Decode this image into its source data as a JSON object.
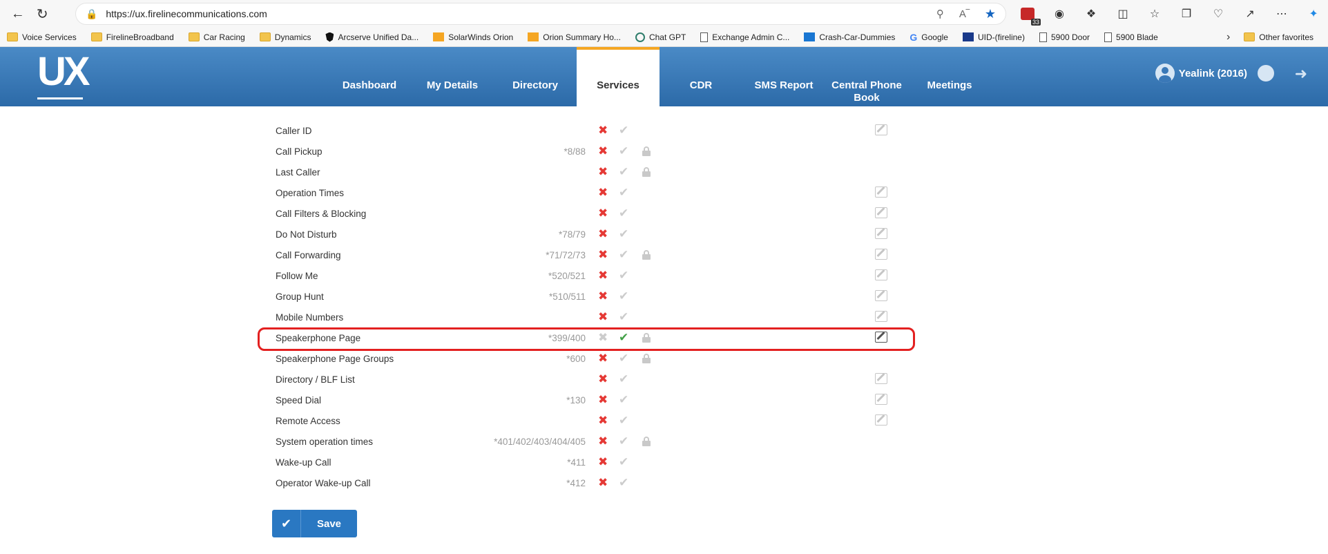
{
  "browser": {
    "url": "https://ux.firelinecommunications.com",
    "extension_badge": "33",
    "bookmarks": [
      {
        "label": "Voice Services",
        "icon": "folder-icon"
      },
      {
        "label": "FirelineBroadband",
        "icon": "folder-icon"
      },
      {
        "label": "Car Racing",
        "icon": "folder-icon"
      },
      {
        "label": "Dynamics",
        "icon": "folder-icon"
      },
      {
        "label": "Arcserve Unified Da...",
        "icon": "shield-icon"
      },
      {
        "label": "SolarWinds Orion",
        "icon": "orion-icon"
      },
      {
        "label": "Orion Summary Ho...",
        "icon": "orion-icon"
      },
      {
        "label": "Chat GPT",
        "icon": "chatgpt-icon"
      },
      {
        "label": "Exchange Admin C...",
        "icon": "page-icon"
      },
      {
        "label": "Crash-Car-Dummies",
        "icon": "dsm-icon"
      },
      {
        "label": "Google",
        "icon": "google-icon"
      },
      {
        "label": "UID-(fireline)",
        "icon": "uid-icon"
      },
      {
        "label": "5900 Door",
        "icon": "page-icon"
      },
      {
        "label": "5900 Blade",
        "icon": "page-icon"
      }
    ],
    "other_favorites": "Other favorites"
  },
  "app": {
    "logo": "UX",
    "nav": [
      "Dashboard",
      "My Details",
      "Directory",
      "Services",
      "CDR",
      "SMS Report",
      "Central Phone Book",
      "Meetings"
    ],
    "active_nav": "Services",
    "user": "Yealink (2016)"
  },
  "services": [
    {
      "name": "Caller ID",
      "code": "",
      "enabled": false,
      "locked": false,
      "editable": true
    },
    {
      "name": "Call Pickup",
      "code": "*8/88",
      "enabled": false,
      "locked": true,
      "editable": false
    },
    {
      "name": "Last Caller",
      "code": "",
      "enabled": false,
      "locked": true,
      "editable": false
    },
    {
      "name": "Operation Times",
      "code": "",
      "enabled": false,
      "locked": false,
      "editable": true
    },
    {
      "name": "Call Filters & Blocking",
      "code": "",
      "enabled": false,
      "locked": false,
      "editable": true
    },
    {
      "name": "Do Not Disturb",
      "code": "*78/79",
      "enabled": false,
      "locked": false,
      "editable": true
    },
    {
      "name": "Call Forwarding",
      "code": "*71/72/73",
      "enabled": false,
      "locked": true,
      "editable": true
    },
    {
      "name": "Follow Me",
      "code": "*520/521",
      "enabled": false,
      "locked": false,
      "editable": true
    },
    {
      "name": "Group Hunt",
      "code": "*510/511",
      "enabled": false,
      "locked": false,
      "editable": true
    },
    {
      "name": "Mobile Numbers",
      "code": "",
      "enabled": false,
      "locked": false,
      "editable": true
    },
    {
      "name": "Speakerphone Page",
      "code": "*399/400",
      "enabled": true,
      "locked": true,
      "editable": true
    },
    {
      "name": "Speakerphone Page Groups",
      "code": "*600",
      "enabled": false,
      "locked": true,
      "editable": false
    },
    {
      "name": "Directory / BLF List",
      "code": "",
      "enabled": false,
      "locked": false,
      "editable": true
    },
    {
      "name": "Speed Dial",
      "code": "*130",
      "enabled": false,
      "locked": false,
      "editable": true
    },
    {
      "name": "Remote Access",
      "code": "",
      "enabled": false,
      "locked": false,
      "editable": true
    },
    {
      "name": "System operation times",
      "code": "*401/402/403/404/405",
      "enabled": false,
      "locked": true,
      "editable": false
    },
    {
      "name": "Wake-up Call",
      "code": "*411",
      "enabled": false,
      "locked": false,
      "editable": false
    },
    {
      "name": "Operator Wake-up Call",
      "code": "*412",
      "enabled": false,
      "locked": false,
      "editable": false
    }
  ],
  "highlighted_service": "Speakerphone Page",
  "save_label": "Save",
  "colors": {
    "header_top": "#4a8ac6",
    "header_bottom": "#2c6aa8",
    "active_tab_accent": "#f5a623",
    "disabled_x": "#e53935",
    "enabled_check": "#43a047",
    "highlight": "#e32020",
    "save_button": "#2a78c2"
  }
}
